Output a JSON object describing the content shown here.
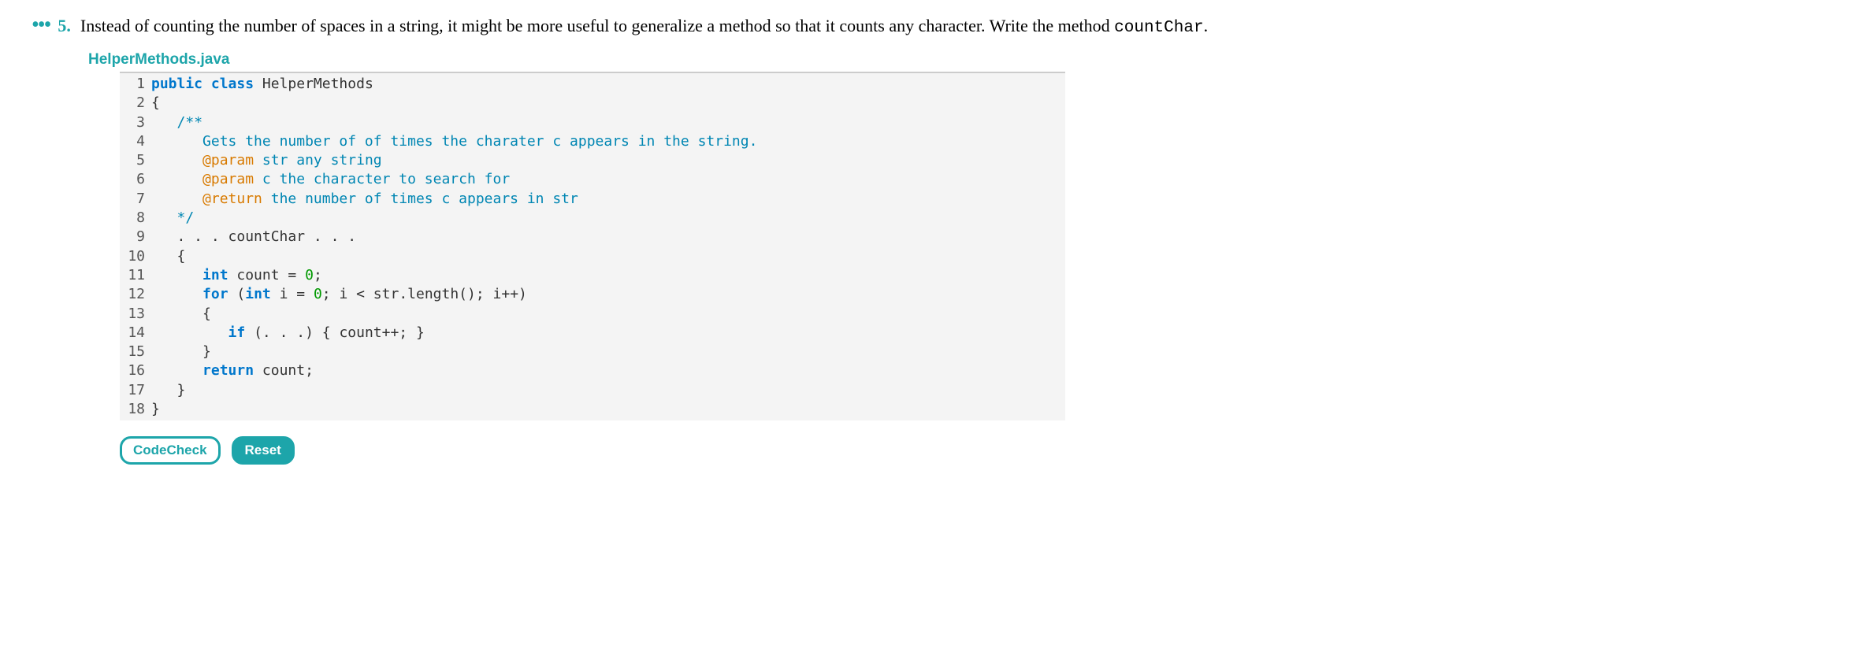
{
  "question": {
    "dots": "•••",
    "number": "5.",
    "text_before_code": "Instead of counting the number of spaces in a string, it might be more useful to generalize a method so that it counts any character. Write the method ",
    "code_word": "countChar",
    "text_after_code": "."
  },
  "filename": "HelperMethods.java",
  "code_lines": [
    {
      "n": "1",
      "segs": [
        {
          "t": "public",
          "c": "kw"
        },
        {
          "t": " ",
          "c": "plain"
        },
        {
          "t": "class",
          "c": "kw"
        },
        {
          "t": " HelperMethods",
          "c": "plain"
        }
      ]
    },
    {
      "n": "2",
      "segs": [
        {
          "t": "{",
          "c": "plain"
        }
      ]
    },
    {
      "n": "3",
      "segs": [
        {
          "t": "   ",
          "c": "plain"
        },
        {
          "t": "/**",
          "c": "cmt"
        }
      ]
    },
    {
      "n": "4",
      "segs": [
        {
          "t": "      ",
          "c": "plain"
        },
        {
          "t": "Gets the number of of times the charater c appears in the string.",
          "c": "cmt"
        }
      ]
    },
    {
      "n": "5",
      "segs": [
        {
          "t": "      ",
          "c": "plain"
        },
        {
          "t": "@param",
          "c": "cmt-orange"
        },
        {
          "t": " str any string",
          "c": "cmt"
        }
      ]
    },
    {
      "n": "6",
      "segs": [
        {
          "t": "      ",
          "c": "plain"
        },
        {
          "t": "@param",
          "c": "cmt-orange"
        },
        {
          "t": " c the character to search for",
          "c": "cmt"
        }
      ]
    },
    {
      "n": "7",
      "segs": [
        {
          "t": "      ",
          "c": "plain"
        },
        {
          "t": "@return",
          "c": "cmt-orange"
        },
        {
          "t": " the number of times c appears in str",
          "c": "cmt"
        }
      ]
    },
    {
      "n": "8",
      "segs": [
        {
          "t": "   ",
          "c": "plain"
        },
        {
          "t": "*/",
          "c": "cmt"
        }
      ]
    },
    {
      "n": "9",
      "segs": [
        {
          "t": "   . . . countChar . . .",
          "c": "plain"
        }
      ]
    },
    {
      "n": "10",
      "segs": [
        {
          "t": "   {",
          "c": "plain"
        }
      ]
    },
    {
      "n": "11",
      "segs": [
        {
          "t": "      ",
          "c": "plain"
        },
        {
          "t": "int",
          "c": "kw"
        },
        {
          "t": " count = ",
          "c": "plain"
        },
        {
          "t": "0",
          "c": "num"
        },
        {
          "t": ";",
          "c": "plain"
        }
      ]
    },
    {
      "n": "12",
      "segs": [
        {
          "t": "      ",
          "c": "plain"
        },
        {
          "t": "for",
          "c": "kw"
        },
        {
          "t": " (",
          "c": "plain"
        },
        {
          "t": "int",
          "c": "kw"
        },
        {
          "t": " i = ",
          "c": "plain"
        },
        {
          "t": "0",
          "c": "num"
        },
        {
          "t": "; i < str.length(); i++)",
          "c": "plain"
        }
      ]
    },
    {
      "n": "13",
      "segs": [
        {
          "t": "      {",
          "c": "plain"
        }
      ]
    },
    {
      "n": "14",
      "segs": [
        {
          "t": "         ",
          "c": "plain"
        },
        {
          "t": "if",
          "c": "kw"
        },
        {
          "t": " (. . .) { count++; }",
          "c": "plain"
        }
      ]
    },
    {
      "n": "15",
      "segs": [
        {
          "t": "      }",
          "c": "plain"
        }
      ]
    },
    {
      "n": "16",
      "segs": [
        {
          "t": "      ",
          "c": "plain"
        },
        {
          "t": "return",
          "c": "kw"
        },
        {
          "t": " count;",
          "c": "plain"
        }
      ]
    },
    {
      "n": "17",
      "segs": [
        {
          "t": "   }",
          "c": "plain"
        }
      ]
    },
    {
      "n": "18",
      "segs": [
        {
          "t": "}",
          "c": "plain"
        }
      ]
    }
  ],
  "buttons": {
    "codecheck": "CodeCheck",
    "reset": "Reset"
  }
}
